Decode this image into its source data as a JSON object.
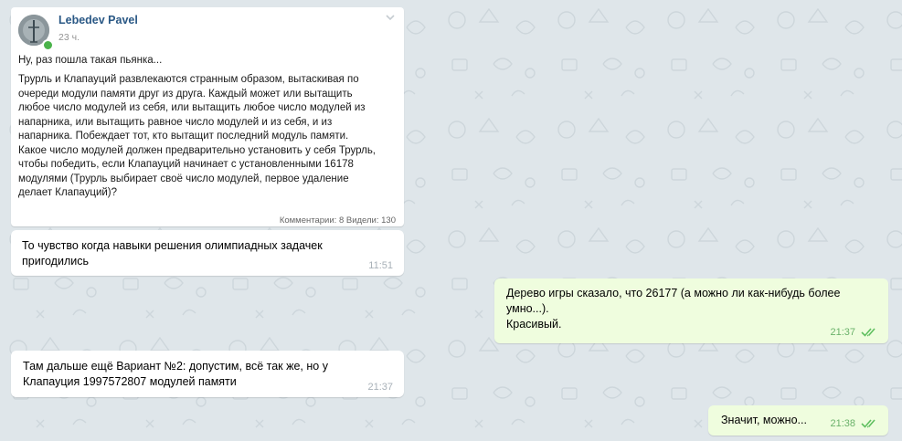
{
  "forwarded_post": {
    "author": "Lebedev Pavel",
    "time": "23 ч.",
    "intro": "Ну, раз пошла такая пьянка...",
    "body": "Трурль и Клапауций развлекаются странным образом, вытаскивая по\nочереди модули памяти друг из друга. Каждый может или вытащить\nлюбое число модулей из себя, или вытащить любое число модулей из\nнапарника, или вытащить равное число модулей и из себя, и из\nнапарника. Побеждает тот, кто вытащит последний модуль памяти.\nКакое число модулей должен предварительно установить у себя Трурль,\nчтобы победить, если Клапауций начинает с установленными 16178\nмодулями (Трурль выбирает своё число модулей, первое удаление\nделает Клапауций)?",
    "stats": "Комментарии: 8  Видели: 130"
  },
  "messages": [
    {
      "direction": "incoming",
      "text": "То чувство когда навыки решения олимпиадных задачек\nпригодились",
      "time": "11:51"
    },
    {
      "direction": "outgoing",
      "text": "Дерево игры сказало, что 26177 (а можно ли как-нибудь более\nумно...).\nКрасивый.",
      "time": "21:37",
      "status": "read"
    },
    {
      "direction": "incoming",
      "text": "Там дальше ещё Вариант №2: допустим, всё так же, но у\nКлапауция 1997572807 модулей памяти",
      "time": "21:37"
    },
    {
      "direction": "outgoing",
      "text": "Значит, можно...",
      "time": "21:38",
      "status": "read"
    }
  ],
  "colors": {
    "wallpaper": "#dfe6ea",
    "incoming_bubble": "#ffffff",
    "outgoing_bubble": "#effdde",
    "author_link": "#2a5885",
    "read_ticks": "#5fbf5f",
    "online": "#4bb34b"
  },
  "icons": {
    "expand": "chevron-down-icon",
    "read_status": "double-check-icon",
    "avatar": "avatar-photo"
  }
}
